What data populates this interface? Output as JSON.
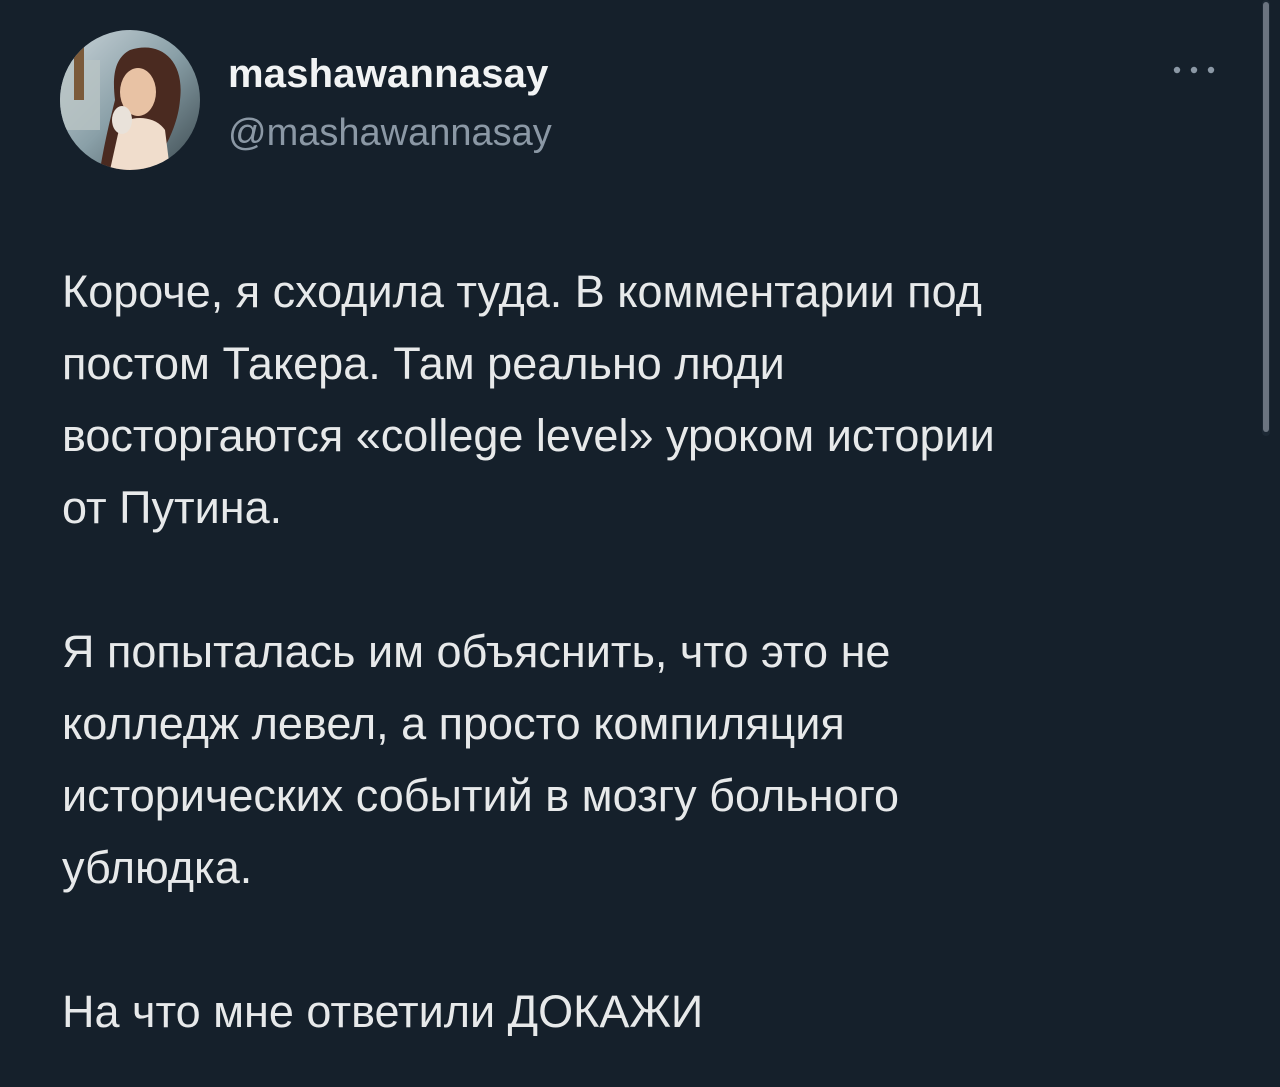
{
  "author": {
    "display_name": "mashawannasay",
    "handle": "@mashawannasay",
    "avatar_icon": "profile-photo"
  },
  "actions": {
    "more_icon": "more-horizontal-icon"
  },
  "tweet": {
    "paragraphs": [
      {
        "lines": [
          "Короче, я сходила туда. В комментарии под",
          "постом Такера. Там реально люди",
          "восторгаются «college level» уроком истории",
          "от Путина."
        ]
      },
      {
        "lines": [
          "Я попыталась им объяснить, что это не",
          "колледж левел, а просто компиляция",
          "исторических событий в мозгу больного",
          "ублюдка."
        ]
      },
      {
        "lines": [
          "На что мне ответили ДОКАЖИ"
        ]
      }
    ]
  },
  "colors": {
    "background": "#15202b",
    "text_primary": "#e7e9ea",
    "text_secondary": "#8b98a5"
  }
}
